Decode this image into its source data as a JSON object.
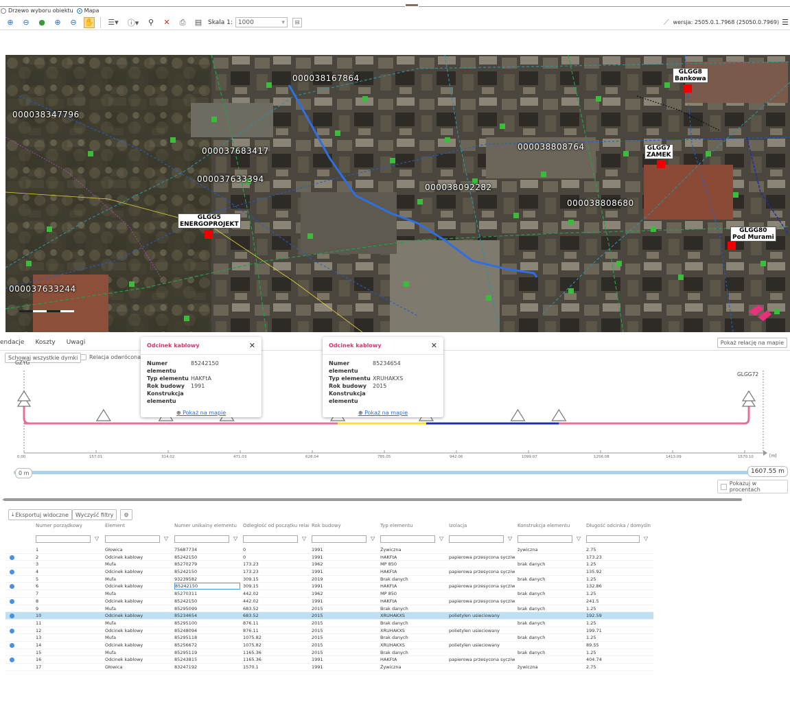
{
  "view_toggle": {
    "tree_label": "Drzewo wyboru obiektu",
    "map_label": "Mapa"
  },
  "toolbar": {
    "scale_label": "Skala 1:",
    "scale_value": "1000",
    "version_label": "wersja: 2505.0.1.7968 (25050.0.7969)"
  },
  "map": {
    "cable_labels": [
      {
        "text": "000038347796"
      },
      {
        "text": "000038167864"
      },
      {
        "text": "000037683417"
      },
      {
        "text": "000037633394"
      },
      {
        "text": "000038808764"
      },
      {
        "text": "000038092282"
      },
      {
        "text": "000038808680"
      },
      {
        "text": "000037633244"
      }
    ],
    "stations": [
      {
        "line1": "GLGG8",
        "line2": "Bankowa"
      },
      {
        "line1": "GLGG7",
        "line2": "ZAMEK"
      },
      {
        "line1": "GLGG5",
        "line2": "ENERGOPROJEKT"
      },
      {
        "line1": "GLGG80",
        "line2": "Pod Murami"
      }
    ]
  },
  "panel": {
    "tabs": [
      "endacje",
      "Koszty",
      "Uwagi"
    ],
    "show_relation_btn": "Pokaż relację na mapie",
    "hide_tooltips_btn": "Schowaj wszystkie dymki",
    "reverse_relation_label": "Relacja odwrócona",
    "start_node": "GZYG",
    "end_node": "GLGG72",
    "axis_ticks": [
      "0.00",
      "157.01",
      "314.02",
      "471.03",
      "628.04",
      "785.05",
      "942.06",
      "1099.07",
      "1256.08",
      "1413.09",
      "1570.10"
    ],
    "axis_unit": "[m]",
    "range_start": "0 m",
    "range_end": "1607.55 m",
    "percent_label": "Pokazuj w procentach"
  },
  "popups": [
    {
      "title": "Odcinek kablowy",
      "rows": [
        {
          "k": "Numer elementu",
          "v": "85242150"
        },
        {
          "k": "Typ elementu",
          "v": "HAKFtA"
        },
        {
          "k": "Rok budowy",
          "v": "1991"
        },
        {
          "k": "Konstrukcja elementu",
          "v": ""
        }
      ],
      "link": "Pokaż na mapie"
    },
    {
      "title": "Odcinek kablowy",
      "rows": [
        {
          "k": "Numer elementu",
          "v": "85234654"
        },
        {
          "k": "Typ elementu",
          "v": "XRUHAKXS"
        },
        {
          "k": "Rok budowy",
          "v": "2015"
        },
        {
          "k": "Konstrukcja elementu",
          "v": ""
        }
      ],
      "link": "Pokaż na mapie"
    }
  ],
  "grid_toolbar": {
    "export_btn": "Eksportuj widoczne",
    "clear_btn": "Wyczyść filtry"
  },
  "columns": [
    "Numer porządkowy",
    "Element",
    "Numer unikalny elementu",
    "Odległość od początku relacji ...",
    "Rok budowy",
    "Typ elementu",
    "Izolacja",
    "Konstrukcja elementu",
    "Długość odcinka / domyślna d..."
  ],
  "rows": [
    [
      "1",
      "Głowica",
      "75687734",
      "0",
      "1991",
      "Żywiczna",
      "",
      "żywiczna",
      "2.75"
    ],
    [
      "2",
      "Odcinek kablowy",
      "85242150",
      "0",
      "1991",
      "HAKFtA",
      "papierowa przesycona sycziwem",
      "",
      "173.23"
    ],
    [
      "3",
      "Mufa",
      "85270279",
      "173.23",
      "1962",
      "MP 850",
      "",
      "brak danych",
      "1.25"
    ],
    [
      "4",
      "Odcinek kablowy",
      "85242150",
      "173.23",
      "1991",
      "HAKFtA",
      "papierowa przesycona sycziwem",
      "",
      "135.92"
    ],
    [
      "5",
      "Mufa",
      "93239582",
      "309.15",
      "2019",
      "Brak danych",
      "",
      "brak danych",
      "1.25"
    ],
    [
      "6",
      "Odcinek kablowy",
      "85242150",
      "309.15",
      "1991",
      "HAKFtA",
      "papierowa przesycona sycziwem",
      "",
      "132.86"
    ],
    [
      "7",
      "Mufa",
      "85270311",
      "442.02",
      "1962",
      "MP 850",
      "",
      "brak danych",
      "1.25"
    ],
    [
      "8",
      "Odcinek kablowy",
      "85242150",
      "442.02",
      "1991",
      "HAKFtA",
      "papierowa przesycona sycziwem",
      "",
      "241.5"
    ],
    [
      "9",
      "Mufa",
      "85295099",
      "683.52",
      "2015",
      "Brak danych",
      "",
      "brak danych",
      "1.25"
    ],
    [
      "10",
      "Odcinek kablowy",
      "85234654",
      "683.52",
      "2015",
      "XRUHAKXS",
      "polietylen usieciowany",
      "",
      "192.59"
    ],
    [
      "11",
      "Mufa",
      "85295100",
      "876.11",
      "2015",
      "Brak danych",
      "",
      "brak danych",
      "1.25"
    ],
    [
      "12",
      "Odcinek kablowy",
      "85248094",
      "876.11",
      "2015",
      "XRUHAKXS",
      "polietylen usieciowany",
      "",
      "199.71"
    ],
    [
      "13",
      "Mufa",
      "85295118",
      "1075.82",
      "2015",
      "Brak danych",
      "",
      "brak danych",
      "1.25"
    ],
    [
      "14",
      "Odcinek kablowy",
      "85256672",
      "1075.82",
      "2015",
      "XRUHAKXS",
      "polietylen usieciowany",
      "",
      "89.55"
    ],
    [
      "15",
      "Mufa",
      "85295119",
      "1165.36",
      "2015",
      "Brak danych",
      "",
      "brak danych",
      "1.25"
    ],
    [
      "16",
      "Odcinek kablowy",
      "85243815",
      "1165.36",
      "1991",
      "HAKFtA",
      "papierowa przesycona sycziwem",
      "",
      "404.74"
    ],
    [
      "17",
      "Głowica",
      "83247192",
      "1570.1",
      "1991",
      "Żywiczna",
      "",
      "żywiczna",
      "2.75"
    ]
  ],
  "selected_row": "10",
  "colors": {
    "pink": "#e0719a",
    "yellow": "#f5e13a",
    "blue": "#1f2fa8",
    "accent": "#d9346f",
    "route": "#2f6fe0"
  }
}
